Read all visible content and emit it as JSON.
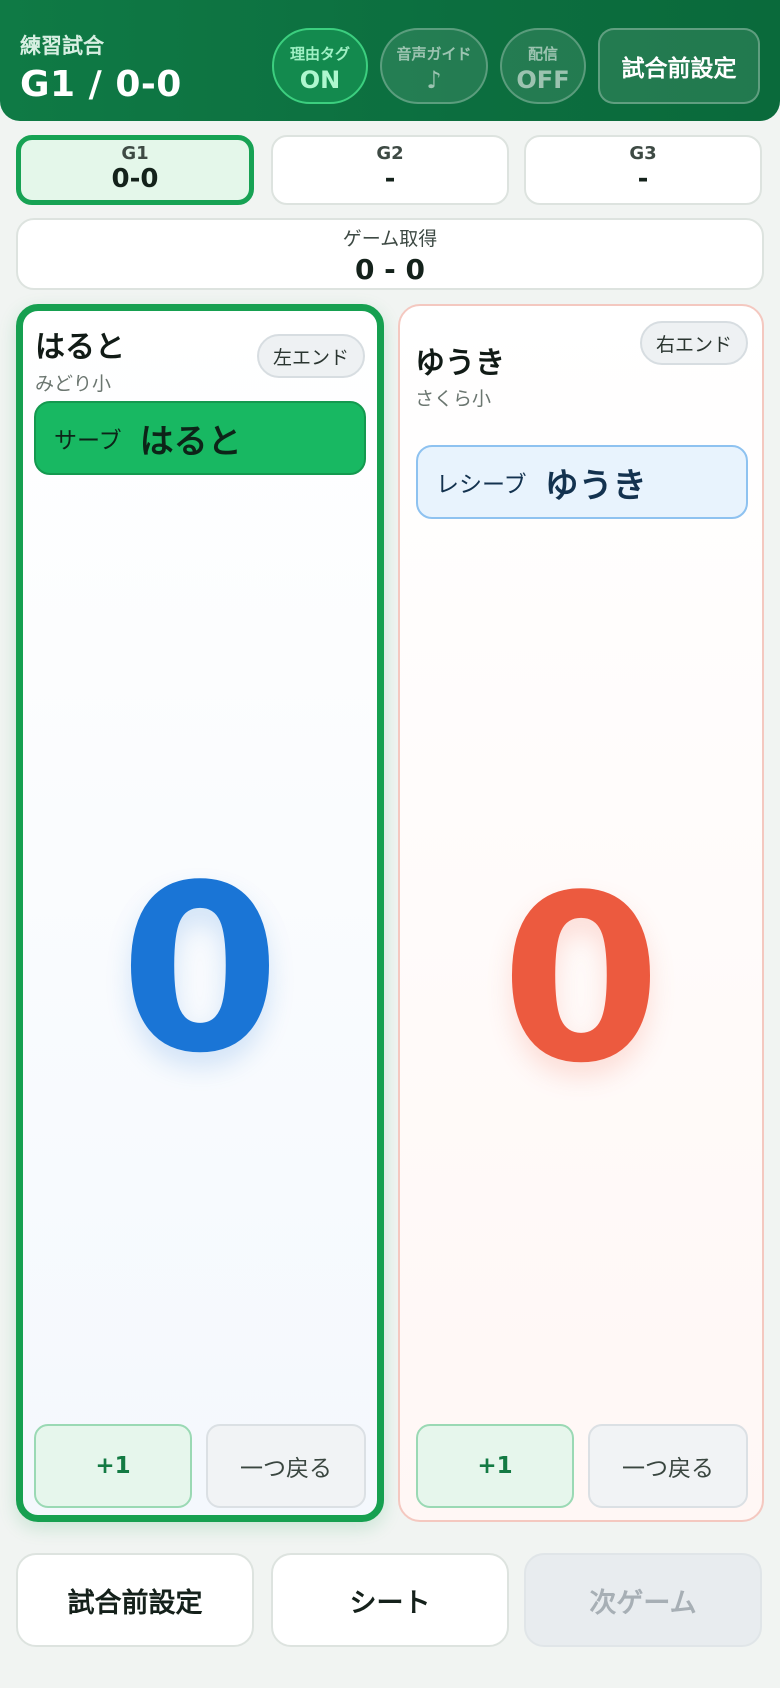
{
  "header": {
    "mode_label": "練習試合",
    "title": "G1 / 0-0",
    "reason_tag": {
      "label": "理由タグ",
      "value": "ON"
    },
    "voice_guide": {
      "label": "音声ガイド",
      "value": "♪"
    },
    "stream": {
      "label": "配信",
      "value": "OFF"
    },
    "setup_button": "試合前設定"
  },
  "games": [
    {
      "label": "G1",
      "score": "0-0",
      "active": true
    },
    {
      "label": "G2",
      "score": "-",
      "active": false
    },
    {
      "label": "G3",
      "score": "-",
      "active": false
    }
  ],
  "games_won": {
    "label": "ゲーム取得",
    "score": "0 - 0"
  },
  "players": {
    "left": {
      "name": "はると",
      "school": "みどり小",
      "end": "左エンド",
      "role_label": "サーブ",
      "role_name": "はると",
      "score": "0",
      "plus": "+1",
      "undo": "一つ戻る",
      "color": "#1a75d6"
    },
    "right": {
      "name": "ゆうき",
      "school": "さくら小",
      "end": "右エンド",
      "role_label": "レシーブ",
      "role_name": "ゆうき",
      "score": "0",
      "plus": "+1",
      "undo": "一つ戻る",
      "color": "#ec5a3f"
    }
  },
  "bottom": {
    "setup": "試合前設定",
    "sheet": "シート",
    "next_game": "次ゲーム"
  }
}
